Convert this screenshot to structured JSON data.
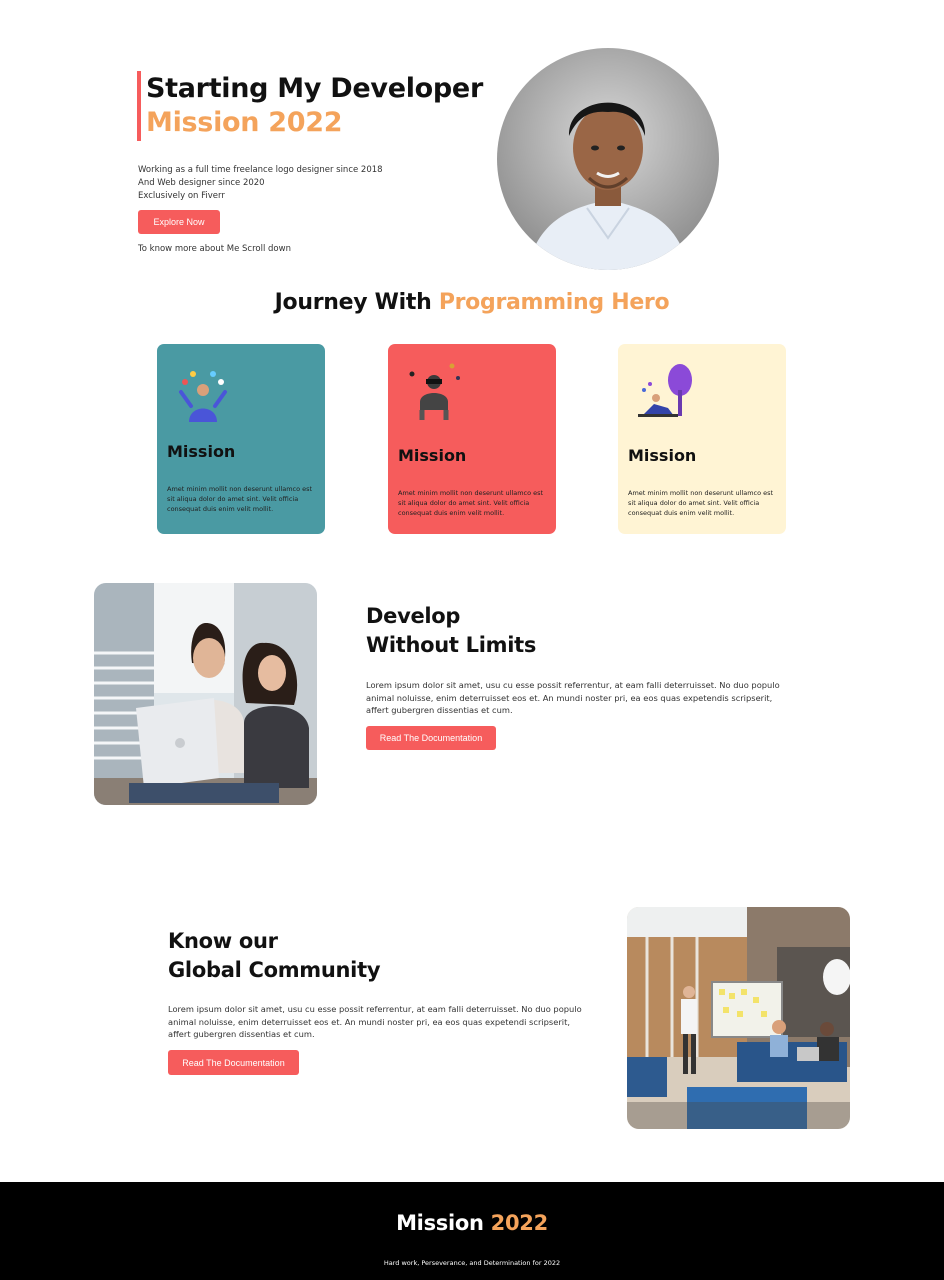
{
  "hero": {
    "title_line1": "Starting My Developer",
    "title_line2": "Mission 2022",
    "desc_line1": "Working as a full time freelance logo designer since 2018",
    "desc_line2": "And Web designer since 2020",
    "desc_line3": "Exclusively on Fiverr",
    "cta_label": "Explore Now",
    "note": "To know more about Me Scroll down"
  },
  "journey": {
    "title_part1": "Journey With ",
    "title_part2": "Programming Hero",
    "cards": [
      {
        "title": "Mission",
        "text": "Amet minim mollit non deserunt ullamco est sit aliqua dolor do amet sint. Velit officia consequat duis enim velit mollit.",
        "bg": "#4a9aa3"
      },
      {
        "title": "Mission",
        "text": "Amet minim mollit non deserunt ullamco est sit aliqua dolor do amet sint. Velit officia consequat duis enim velit mollit.",
        "bg": "#f65c5c"
      },
      {
        "title": "Mission",
        "text": "Amet minim mollit non deserunt ullamco est sit aliqua dolor do amet sint. Velit officia consequat duis enim velit mollit.",
        "bg": "#fff4d4"
      }
    ]
  },
  "develop": {
    "title_line1": "Develop",
    "title_line2": "Without Limits",
    "text": "Lorem ipsum dolor sit amet, usu cu esse possit referrentur, at eam falli deterruisset. No duo populo animal noluisse, enim deterruisset eos et. An mundi noster pri, ea eos quas expetendis scripserit, affert gubergren dissentias et cum.",
    "cta_label": "Read The Documentation"
  },
  "community": {
    "title_line1": "Know our",
    "title_line2": "Global Community",
    "text": "Lorem ipsum dolor sit amet, usu cu esse possit referrentur, at eam falli deterruisset. No duo populo animal noluisse, enim deterruisset eos et. An mundi noster pri, ea eos quas expetendi scripserit, affert gubergren dissentias et cum.",
    "cta_label": "Read The Documentation"
  },
  "footer": {
    "title_part1": "Mission ",
    "title_part2": "2022",
    "tagline": "Hard work, Perseverance, and Determination for 2022"
  },
  "colors": {
    "accent": "#f65c5c",
    "highlight": "#f4a35b",
    "footer_bg": "#000000"
  },
  "icons": [
    "profile-photo",
    "juggling-person-illustration",
    "vr-person-illustration",
    "person-under-tree-illustration",
    "women-with-laptop-photo",
    "team-meeting-photo"
  ]
}
